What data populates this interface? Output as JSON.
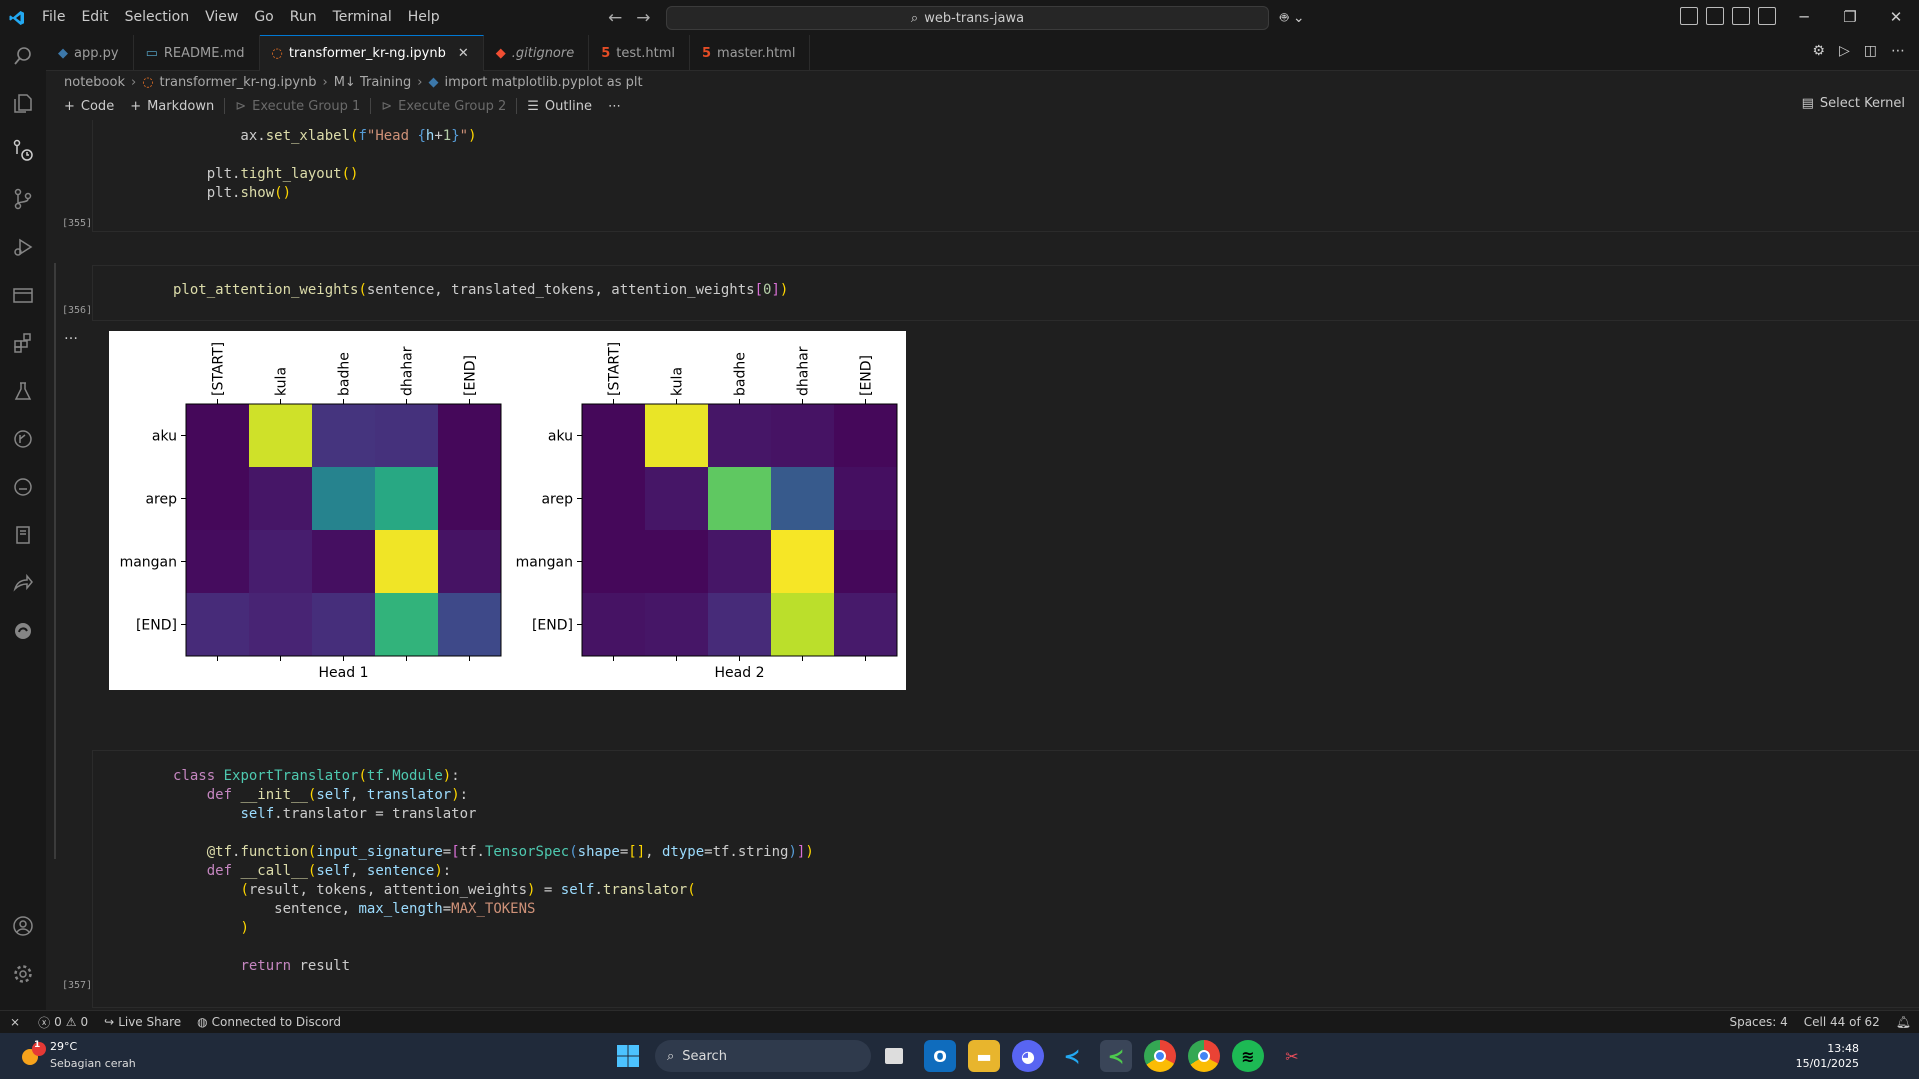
{
  "window": {
    "search_text": "web-trans-jawa"
  },
  "menu": [
    "File",
    "Edit",
    "Selection",
    "View",
    "Go",
    "Run",
    "Terminal",
    "Help"
  ],
  "tabs": [
    {
      "label": "app.py",
      "icon": "python-icon",
      "color": "#3c78aa"
    },
    {
      "label": "README.md",
      "icon": "markdown-icon",
      "color": "#519aba"
    },
    {
      "label": "transformer_kr-ng.ipynb",
      "icon": "jupyter-icon",
      "color": "#f37626"
    },
    {
      "label": ".gitignore",
      "icon": "git-icon",
      "color": "#f14e32"
    },
    {
      "label": "test.html",
      "icon": "html-icon",
      "color": "#e44d26"
    },
    {
      "label": "master.html",
      "icon": "html-icon",
      "color": "#e44d26"
    }
  ],
  "breadcrumb": [
    "notebook",
    "transformer_kr-ng.ipynb",
    "M↓ Training",
    "import matplotlib.pyplot as plt"
  ],
  "toolbar": {
    "code": "Code",
    "markdown": "Markdown",
    "exec1": "Execute Group 1",
    "exec2": "Execute Group 2",
    "outline": "Outline",
    "more": "⋯",
    "kernel": "Select Kernel"
  },
  "cells": {
    "c355": {
      "exec": "[355]"
    },
    "c356": {
      "exec": "[356]"
    },
    "c357": {
      "exec": "[357]"
    },
    "more": "…"
  },
  "chart_data": [
    {
      "type": "heatmap",
      "title": "",
      "xlabel": "Head 1",
      "ylabel": "",
      "x_categories": [
        "[START]",
        "kula",
        "badhe",
        "dhahar",
        "[END]"
      ],
      "y_categories": [
        "aku",
        "arep",
        "mangan",
        "[END]"
      ],
      "values": [
        [
          0.02,
          0.93,
          0.15,
          0.14,
          0.02
        ],
        [
          0.02,
          0.06,
          0.45,
          0.6,
          0.02
        ],
        [
          0.03,
          0.08,
          0.04,
          0.98,
          0.05
        ],
        [
          0.12,
          0.1,
          0.13,
          0.65,
          0.22
        ]
      ]
    },
    {
      "type": "heatmap",
      "title": "",
      "xlabel": "Head 2",
      "ylabel": "",
      "x_categories": [
        "[START]",
        "kula",
        "badhe",
        "dhahar",
        "[END]"
      ],
      "y_categories": [
        "aku",
        "arep",
        "mangan",
        "[END]"
      ],
      "values": [
        [
          0.02,
          0.97,
          0.06,
          0.05,
          0.02
        ],
        [
          0.02,
          0.06,
          0.75,
          0.28,
          0.04
        ],
        [
          0.02,
          0.02,
          0.06,
          0.99,
          0.02
        ],
        [
          0.05,
          0.06,
          0.12,
          0.9,
          0.07
        ]
      ]
    }
  ],
  "status": {
    "errors": "0",
    "warnings": "0",
    "live_share": "Live Share",
    "discord": "Connected to Discord",
    "spaces": "Spaces: 4",
    "cell": "Cell 44 of 62"
  },
  "taskbar": {
    "temp": "29°C",
    "weather": "Sebagian cerah",
    "weather_badge": "1",
    "search": "Search",
    "time": "13:48",
    "date": "15/01/2025"
  }
}
